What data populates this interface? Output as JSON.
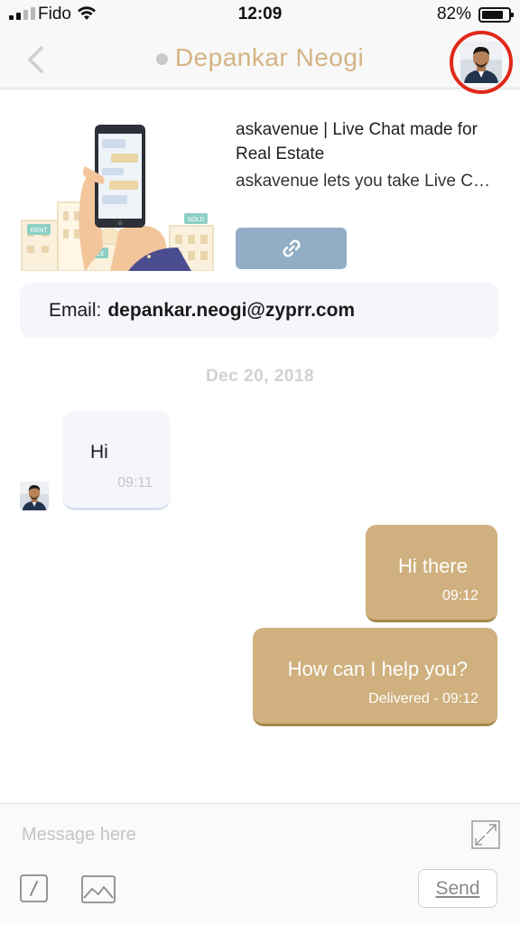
{
  "status_bar": {
    "carrier": "Fido",
    "time": "12:09",
    "battery_percent": "82%",
    "battery_level": 0.82
  },
  "header": {
    "back_icon": "chevron-left-icon",
    "contact_name": "Depankar Neogi",
    "presence_color": "#c9c9c9",
    "title_color": "#d4b483",
    "highlight_ring_color": "#e0281a"
  },
  "link_preview": {
    "title": "askavenue | Live Chat made for Real Estate",
    "description": "askavenue lets you take Live Chat requests from your website",
    "image_tags": [
      "RENT",
      "SALE",
      "SOLD"
    ],
    "link_icon": "link-icon",
    "button_color": "#92aec6"
  },
  "email_card": {
    "label": "Email:",
    "value": "depankar.neogi@zyprr.com"
  },
  "date_separator": "Dec 20, 2018",
  "messages": {
    "incoming": [
      {
        "text": "Hi",
        "time": "09:11"
      }
    ],
    "outgoing": [
      {
        "text": "Hi there",
        "time": "09:12"
      },
      {
        "text": "How can I help you?",
        "time": "Delivered - 09:12"
      }
    ],
    "outgoing_color": "#cfb07e"
  },
  "composer": {
    "placeholder": "Message here",
    "value": "",
    "send_label": "Send",
    "expand_icon": "expand-icon",
    "slash_icon": "slash-command-icon",
    "image_icon": "image-icon"
  }
}
